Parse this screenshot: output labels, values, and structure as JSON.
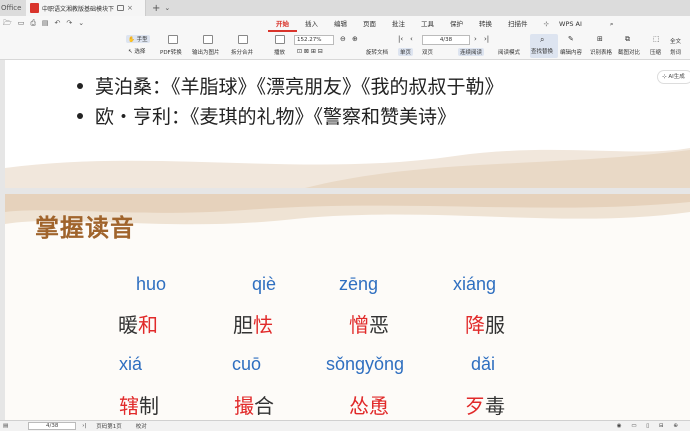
{
  "titlebar": {
    "app_name": "Office",
    "doc_tab_title": "中职语文湘教版基础模块下...",
    "close_glyph": "×",
    "new_tab_glyph": "+",
    "menu_glyph": "⌄"
  },
  "menu": {
    "items": [
      "开始",
      "插入",
      "编辑",
      "页面",
      "批注",
      "工具",
      "保护",
      "转换",
      "扫描件"
    ],
    "active": "开始",
    "wps_ai": "WPS AI"
  },
  "ribbon": {
    "hand": "手型",
    "select": "选择",
    "pdf_convert": "PDF转换",
    "export_image": "输出为图片",
    "split_merge": "拆分合并",
    "play": "播放",
    "zoom": "152.27%",
    "rotate_doc": "旋转文档",
    "single_page": "单页",
    "double_page": "双页",
    "continuous": "连续阅读",
    "read_mode": "阅读模式",
    "page_indicator": "4/38",
    "find_replace": "查找替换",
    "edit_content": "编辑内容",
    "print_table": "识别表格",
    "screenshot_compare": "截图对比",
    "compress": "压缩",
    "full_text": "全文",
    "translate": "划词"
  },
  "ai_button": "AI生成",
  "slide1": {
    "bullets": [
      "莫泊桑：《羊脂球》《漂亮朋友》《我的叔叔于勒》",
      "欧・亨利：《麦琪的礼物》《警察和赞美诗》"
    ]
  },
  "slide2": {
    "title": "掌握读音",
    "pinyin_row1": [
      "huo",
      "qiè",
      "zēng",
      "xiáng"
    ],
    "pinyin_row2": [
      "xiá",
      "cuō",
      "sǒngyǒng",
      "dǎi"
    ],
    "words_row1": [
      {
        "pre": "暖",
        "red": "和",
        "post": ""
      },
      {
        "pre": "胆",
        "red": "怯",
        "post": ""
      },
      {
        "pre": "",
        "red": "憎",
        "post": "恶"
      },
      {
        "pre": "",
        "red": "降",
        "post": "服"
      }
    ],
    "words_row2": [
      {
        "pre": "",
        "red": "辖",
        "post": "制"
      },
      {
        "pre": "",
        "red": "撮",
        "post": "合"
      },
      {
        "pre": "",
        "red": "怂恿",
        "post": ""
      },
      {
        "pre": "",
        "red": "歹",
        "post": "毒"
      }
    ]
  },
  "statusbar": {
    "page": "4/38",
    "page_info": "页码第1页",
    "proofread": "校对"
  },
  "colors": {
    "accent": "#d9342b",
    "pinyin_blue": "#2f6fc0",
    "highlight_red": "#e12a2a",
    "title_brown": "#a0642c"
  }
}
